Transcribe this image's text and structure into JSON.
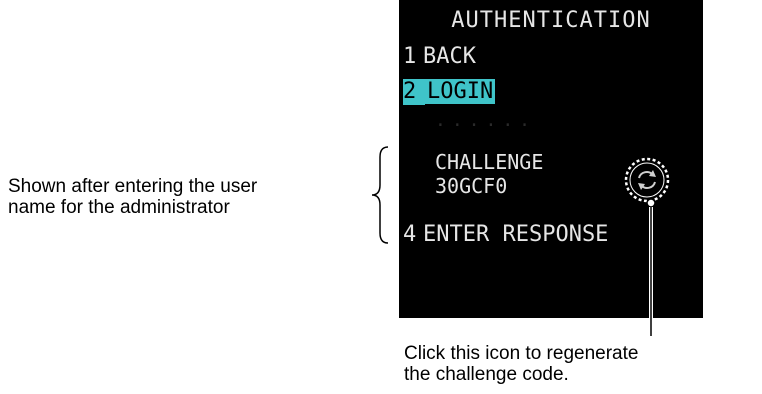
{
  "screen": {
    "title": "AUTHENTICATION",
    "menu": [
      {
        "num": "1",
        "label": "BACK"
      },
      {
        "num": "2",
        "label": "LOGIN",
        "selected": true
      },
      {
        "num": "4",
        "label": "ENTER RESPONSE"
      }
    ],
    "challenge_label": "CHALLENGE",
    "challenge_code": "30GCF0",
    "regenerate_icon": "refresh-icon",
    "colors": {
      "background": "#000000",
      "text": "#e6e6e6",
      "highlight": "#3fc4c9"
    }
  },
  "annotations": {
    "left_note_line1": "Shown after entering the user",
    "left_note_line2": "name for the administrator",
    "bottom_note_line1": "Click this icon to regenerate",
    "bottom_note_line2": "the challenge code."
  }
}
